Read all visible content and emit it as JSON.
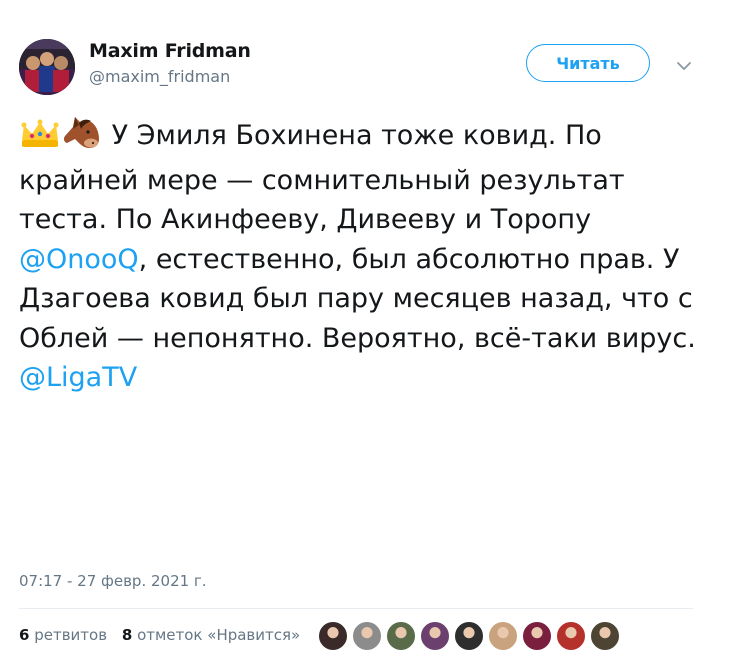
{
  "author": {
    "name": "Maxim Fridman",
    "handle": "@maxim_fridman"
  },
  "follow_button_label": "Читать",
  "menu_icon": "chevron-down-icon",
  "tweet": {
    "emojis": [
      "crown-emoji",
      "horse-face-emoji"
    ],
    "text_1": " У Эмиля Бохинена тоже ковид. По крайней мере — сомнительный результат теста. По Акинфееву, Дивееву и Торопу ",
    "mention_1": "@OnooQ",
    "text_2": ", естественно, был абсолютно прав. У Дзагоева ковид был пару месяцев назад, что с Облей — непонятно. Вероятно, всё-таки вирус. ",
    "mention_2": "@LigaTV"
  },
  "timestamp": "07:17 - 27 февр. 2021 г.",
  "stats": {
    "retweets_count": "6",
    "retweets_label": "ретвитов",
    "likes_count": "8",
    "likes_label": "отметок «Нравится»"
  },
  "colors": {
    "accent": "#1da1f2",
    "secondary_text": "#657786",
    "primary_text": "#14171a",
    "divider": "#e6ecf0"
  },
  "liker_avatars": [
    {
      "color": "#3b2a2a"
    },
    {
      "color": "#8c8c8c"
    },
    {
      "color": "#5a6b4a"
    },
    {
      "color": "#6b3f6e"
    },
    {
      "color": "#2e2e2e"
    },
    {
      "color": "#c9a27e"
    },
    {
      "color": "#7a1f3d"
    },
    {
      "color": "#b5322c"
    },
    {
      "color": "#4d4433"
    }
  ]
}
